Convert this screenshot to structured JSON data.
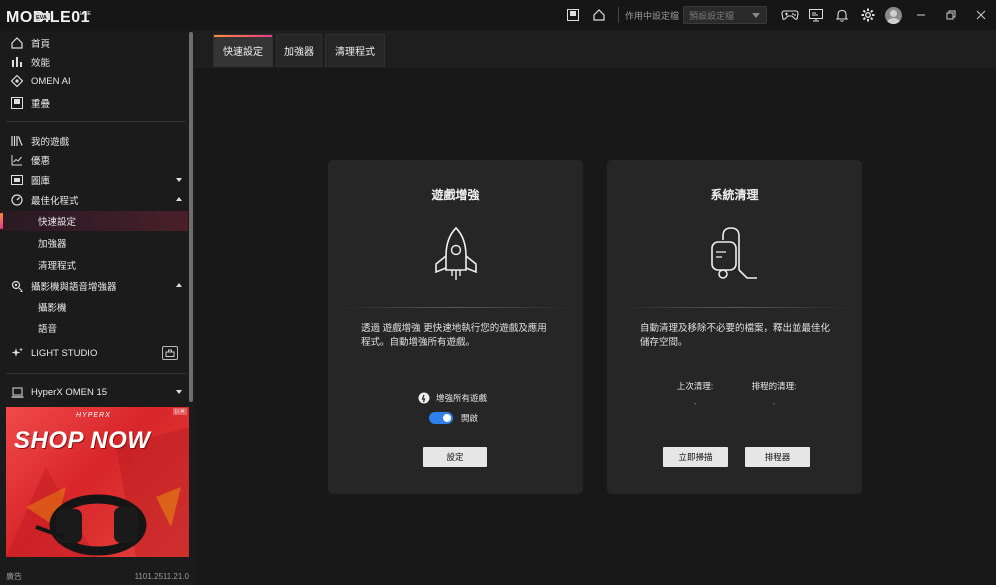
{
  "app": {
    "logo_text": "MOBILE01",
    "logo_badge": "EVA",
    "logo_sub": "LINE"
  },
  "titlebar": {
    "profile_label": "作用中設定檔",
    "profile_value": "預設設定檔"
  },
  "sidebar": {
    "top_items": [
      {
        "label": "首頁",
        "icon": "home-icon"
      },
      {
        "label": "效能",
        "icon": "bar-chart-icon"
      },
      {
        "label": "OMEN AI",
        "icon": "omen-ai-icon"
      },
      {
        "label": "重疊",
        "icon": "overlay-icon"
      }
    ],
    "items": [
      {
        "label": "我的遊戲",
        "icon": "games-library-icon"
      },
      {
        "label": "優惠",
        "icon": "trend-icon"
      },
      {
        "label": "圖庫",
        "icon": "gallery-icon"
      },
      {
        "label": "最佳化程式",
        "icon": "optimizer-gauge-icon"
      }
    ],
    "optimizer_sub": [
      "快速設定",
      "加強器",
      "清理程式"
    ],
    "camera_item": {
      "label": "攝影機與語音增強器",
      "icon": "camera-audio-icon"
    },
    "camera_sub": [
      "攝影機",
      "語音"
    ],
    "light_studio": {
      "label": "LIGHT STUDIO",
      "icon": "sparkle-icon"
    },
    "device": {
      "label": "HyperX OMEN 15",
      "icon": "laptop-icon"
    }
  },
  "ad": {
    "brand": "HYPERX",
    "badge": "▷✕",
    "headline": "SHOP NOW"
  },
  "footer": {
    "left": "廣告",
    "version": "1101.2511.21.0"
  },
  "tabs": [
    "快速設定",
    "加強器",
    "清理程式"
  ],
  "boost_card": {
    "title": "遊戲增強",
    "description": "透過 遊戲增強 更快速地執行您的遊戲及應用程式。自動增強所有遊戲。",
    "toggle_label": "增強所有遊戲",
    "switch_state": "開啟",
    "button": "設定"
  },
  "clean_card": {
    "title": "系統清理",
    "description": "自動清理及移除不必要的檔案，釋出並最佳化儲存空間。",
    "last_clean_label": "上次清理:",
    "last_clean_value": "-",
    "scheduled_label": "排程的清理:",
    "scheduled_value": "-",
    "scan_button": "立即掃描",
    "scheduler_button": "排程器"
  },
  "colors": {
    "accent_start": "#ff8a3d",
    "accent_end": "#e83a8a",
    "toggle_on": "#2f80ed",
    "ad_red": "#e3332f"
  }
}
